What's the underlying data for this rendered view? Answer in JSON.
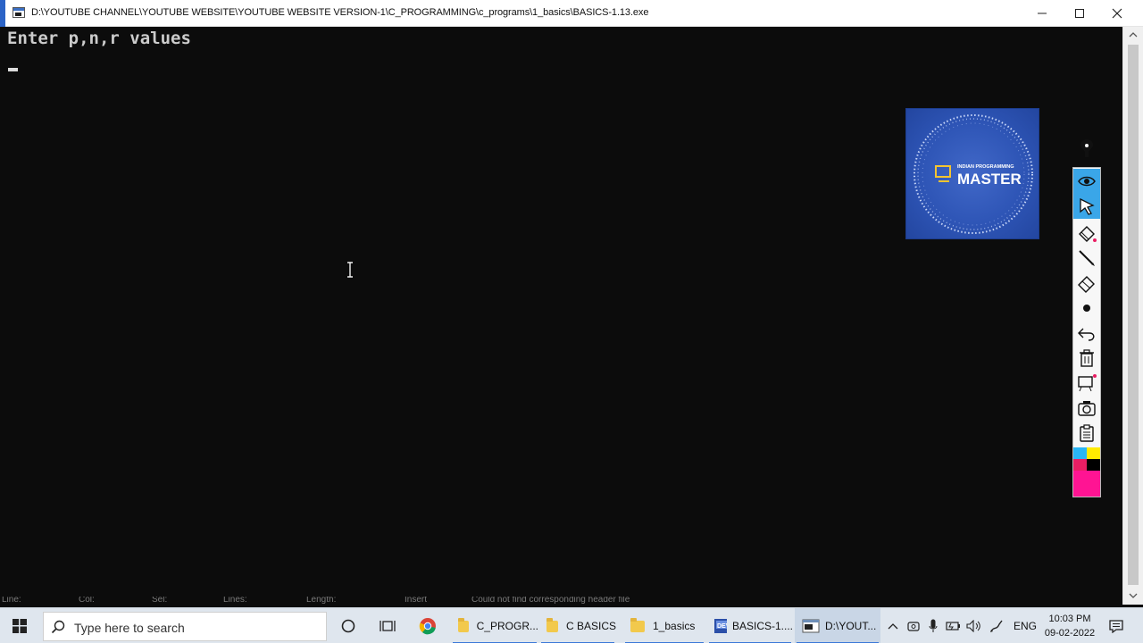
{
  "window": {
    "title": "D:\\YOUTUBE CHANNEL\\YOUTUBE WEBSITE\\YOUTUBE WEBSITE VERSION-1\\C_PROGRAMMING\\c_programs\\1_basics\\BASICS-1.13.exe",
    "controls": [
      "minimize",
      "maximize",
      "close"
    ]
  },
  "console": {
    "output_line": "Enter p,n,r values",
    "background": "#0c0c0c",
    "text_color": "#cccccc"
  },
  "status_bar_ghost": {
    "line": "Line:",
    "col": "Col:",
    "sel": "Sel:",
    "lines": "Lines:",
    "length": "Length:",
    "mode": "Insert",
    "message": "Could not find corresponding header file"
  },
  "logo": {
    "top_text": "INDIAN PROGRAMMING",
    "main_text": "MASTER",
    "background": "#2e55b6"
  },
  "annotation_toolbar": {
    "tools": [
      "pen-icon",
      "eye-icon",
      "cursor-icon",
      "highlighter-icon",
      "line-icon",
      "eraser-icon",
      "dot-icon",
      "undo-icon",
      "trash-icon",
      "whiteboard-icon",
      "camera-icon",
      "clipboard-icon"
    ],
    "active_tools": [
      "eye-icon",
      "cursor-icon"
    ],
    "colors": [
      "#29b6f6",
      "#ffeb00",
      "#e91e63",
      "#000000",
      "#ff1493"
    ]
  },
  "taskbar": {
    "search_placeholder": "Type here to search",
    "apps": [
      {
        "label": "C_PROGR...",
        "icon": "folder-icon"
      },
      {
        "label": "C BASICS",
        "icon": "folder-icon"
      },
      {
        "label": "1_basics",
        "icon": "folder-icon"
      },
      {
        "label": "BASICS-1....",
        "icon": "devcpp-icon"
      },
      {
        "label": "D:\\YOUT...",
        "icon": "console-icon"
      }
    ],
    "language": "ENG",
    "time": "10:03 PM",
    "date": "09-02-2022"
  }
}
